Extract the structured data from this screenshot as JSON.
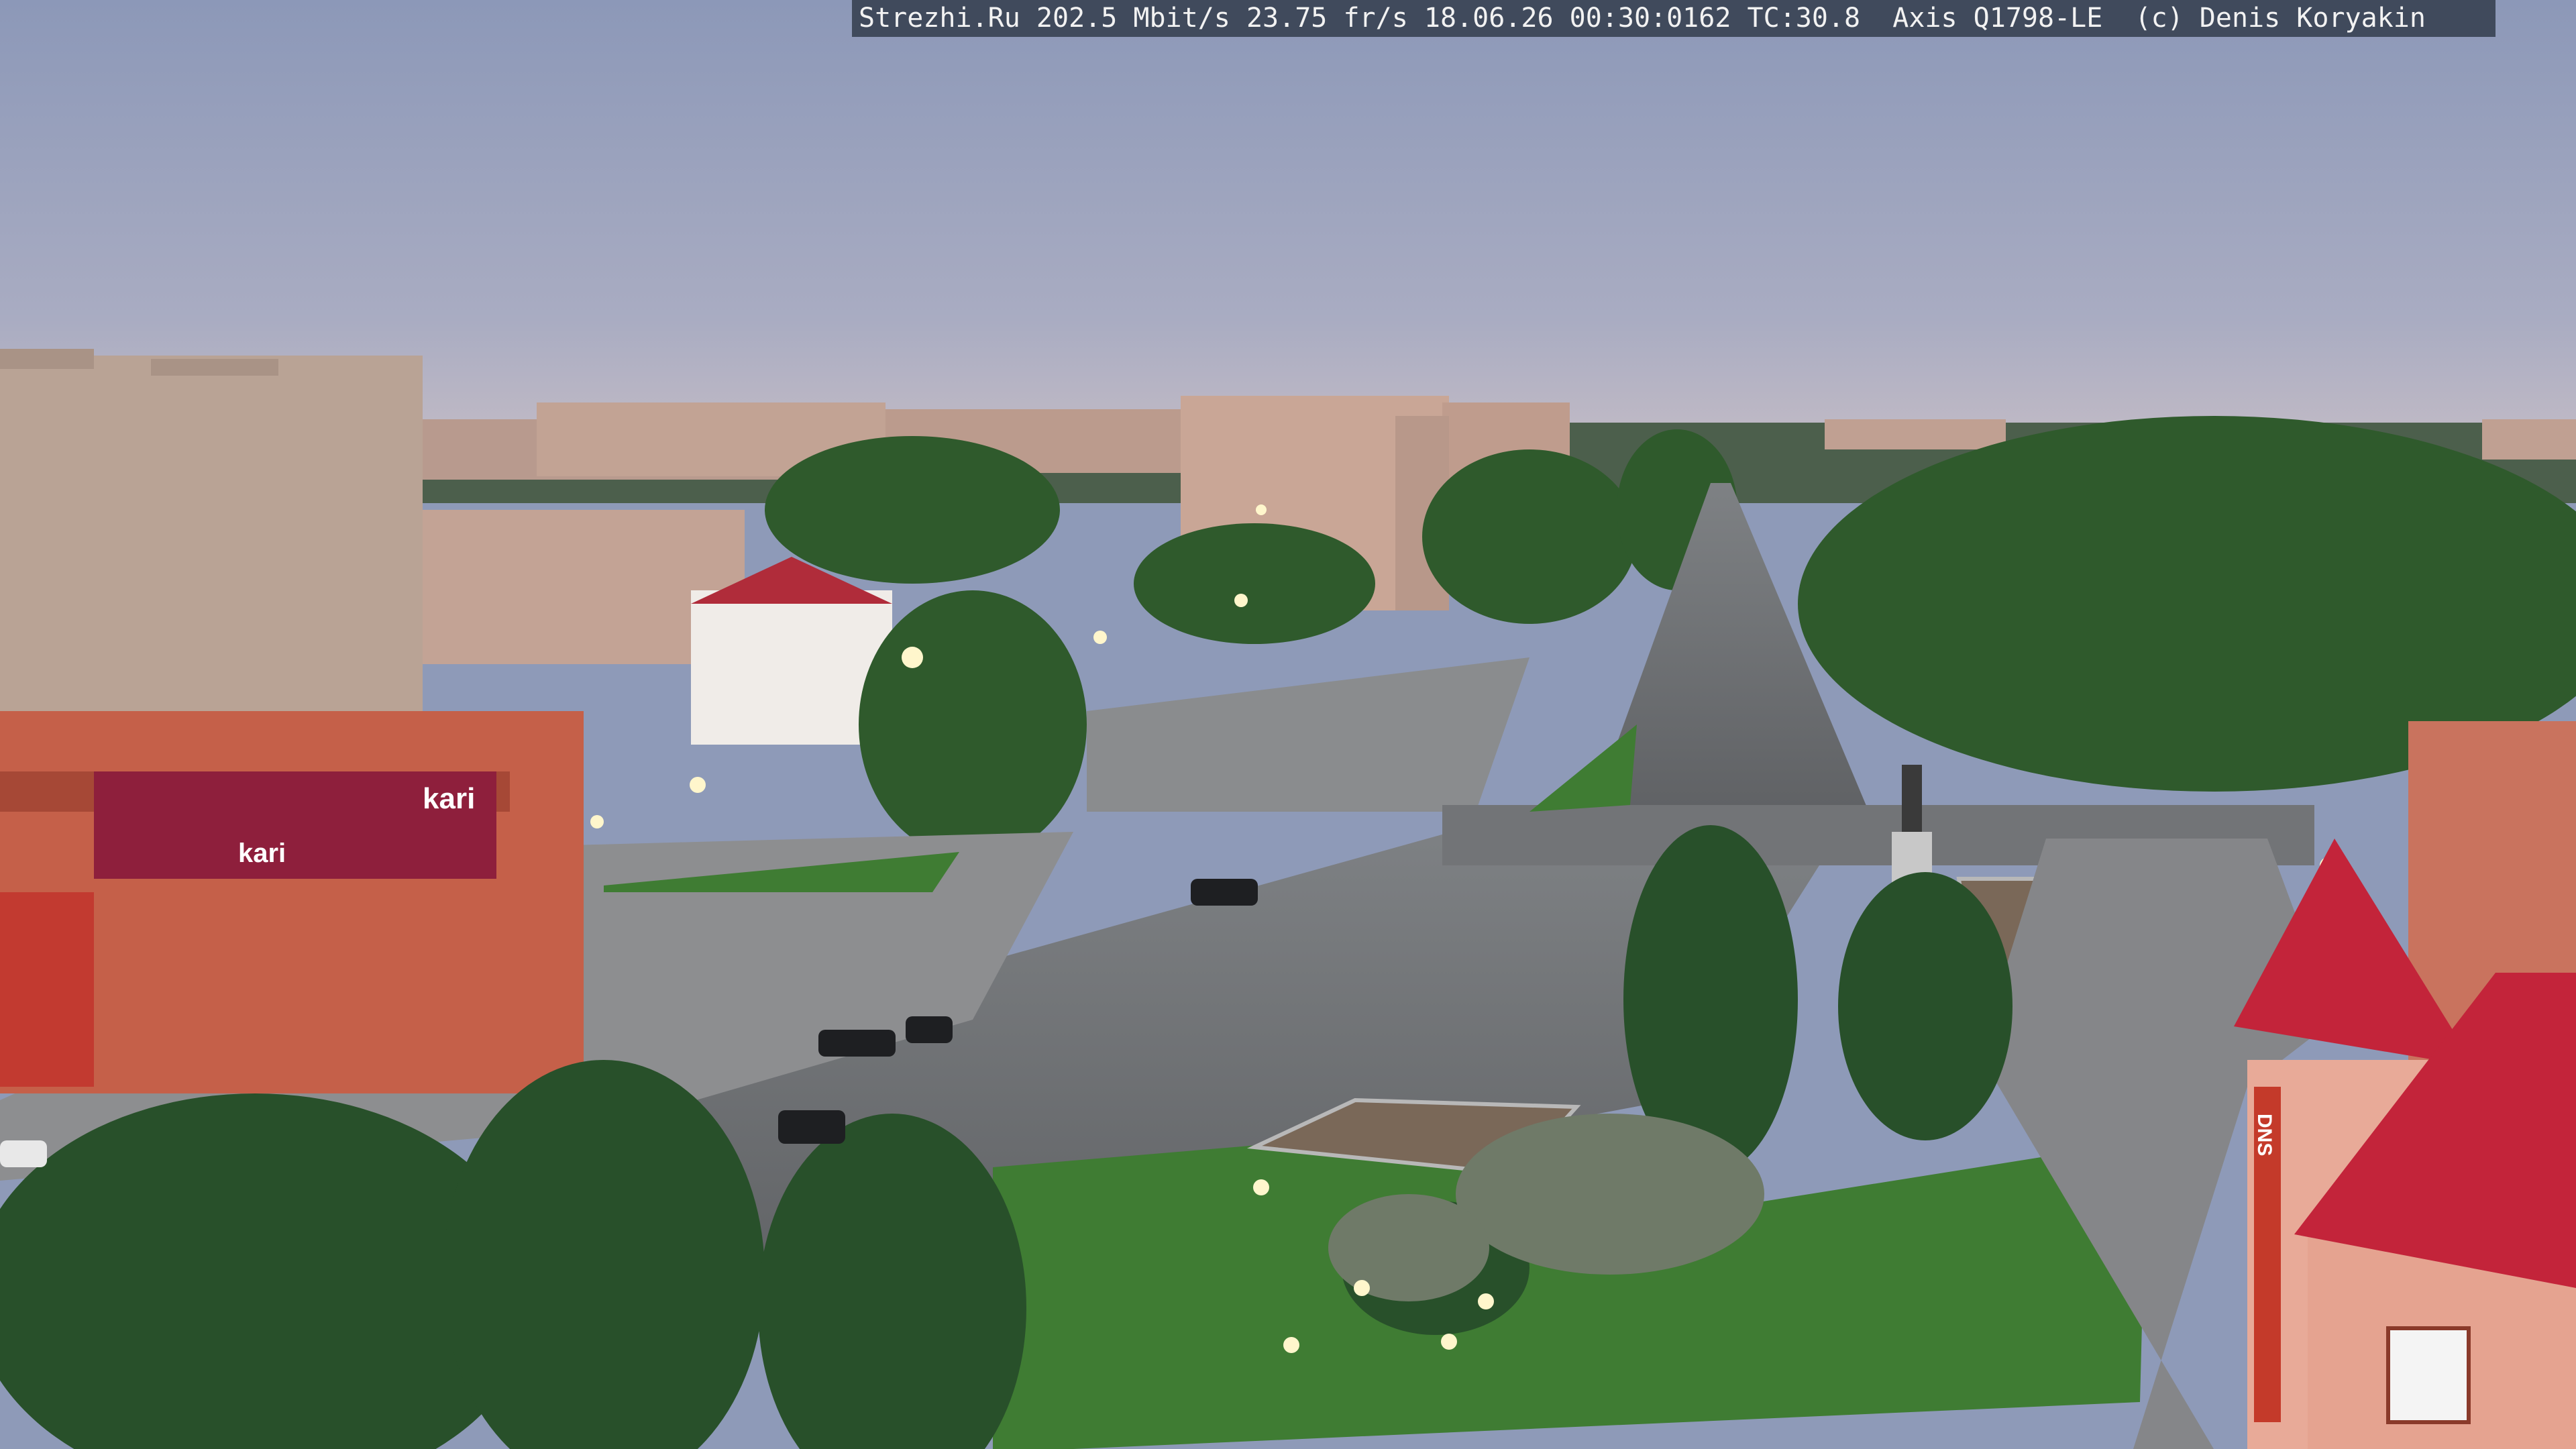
{
  "camera_overlay": {
    "text": "Strezhi.Ru 202.5 Mbit/s 23.75 fr/s 18.06.26 00:30:0162 TC:30.8  Axis Q1798-LE  (c) Denis Koryakin"
  },
  "storefront_signs": {
    "sign_1": "kari",
    "sign_2": "kari"
  },
  "building_sign": {
    "vertical": "DNS"
  },
  "palette": {
    "sky_top": "#8f9cbc",
    "sky_bottom": "#b7b6c4",
    "asphalt": "#6f7174",
    "grass": "#3d7a32",
    "trees": "#2e5a2c",
    "red_roof": "#c0283a",
    "brick": "#c25a44"
  }
}
